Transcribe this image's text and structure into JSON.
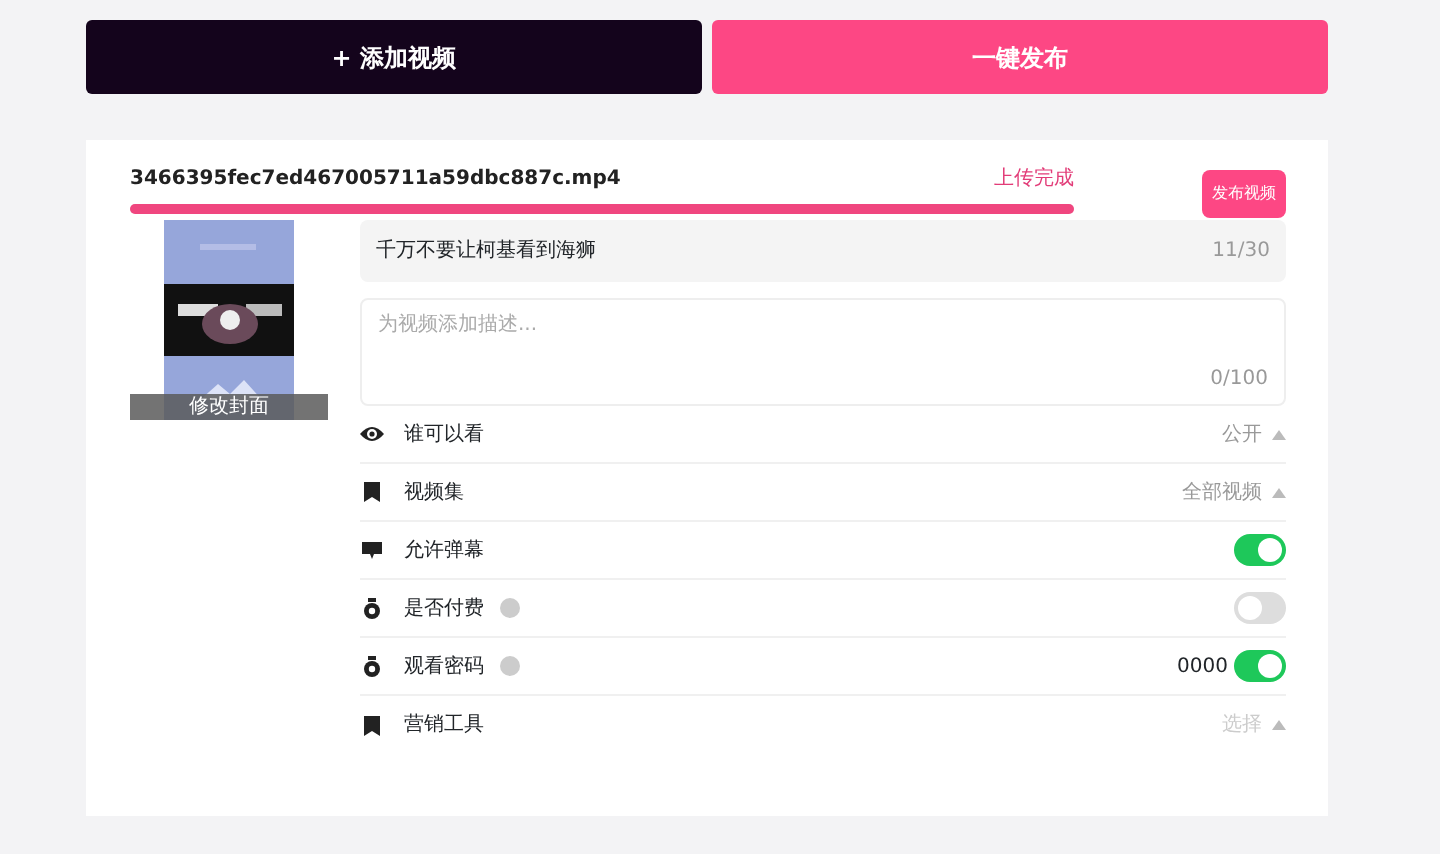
{
  "actions": [
    {
      "label": "+ 添加视频",
      "kind": "dark"
    },
    {
      "label": "一键发布",
      "kind": "pink"
    }
  ],
  "upload": {
    "filename": "3466395fec7ed467005711a59dbc887c.mp4",
    "status": "上传完成",
    "level": 1,
    "publish_button": "发布视频"
  },
  "cover": {
    "label": "修改封面"
  },
  "title_field": {
    "value": "千万不要让柯基看到海狮",
    "count": "11/30"
  },
  "description_field": {
    "placeholder": "为视频添加描述...",
    "count": "0/100"
  },
  "settings": [
    {
      "kind": "select",
      "label": "谁可以看",
      "value": "公开"
    },
    {
      "kind": "select",
      "label": "视频集",
      "value": "全部视频"
    },
    {
      "kind": "toggle",
      "label": "允许弹幕",
      "on": true
    },
    {
      "kind": "toggle",
      "label": "是否付费",
      "help": true,
      "on": false
    },
    {
      "kind": "toggle",
      "label": "观看密码",
      "help": true,
      "value": "0000",
      "on": true
    },
    {
      "kind": "select",
      "label": "营销工具",
      "value": "选择",
      "muted": true
    }
  ]
}
